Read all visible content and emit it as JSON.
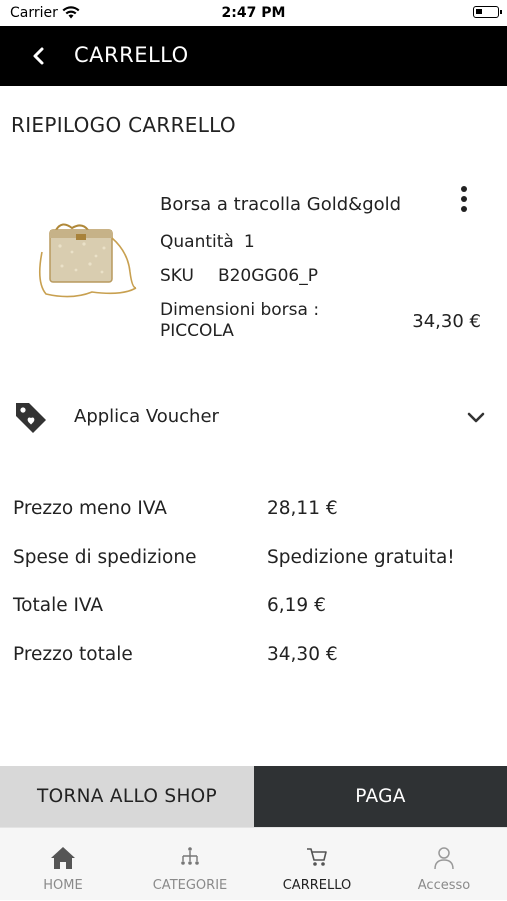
{
  "status_bar": {
    "carrier": "Carrier",
    "time": "2:47 PM"
  },
  "nav": {
    "title": "CARRELLO",
    "back_icon": "chevron-left-icon"
  },
  "cart": {
    "section_title": "RIEPILOGO CARRELLO",
    "item": {
      "name": "Borsa a tracolla Gold&gold",
      "quantity_label": "Quantità",
      "quantity_value": "1",
      "sku_label": "SKU",
      "sku_value": "B20GG06_P",
      "dimension_text": "Dimensioni borsa : PICCOLA",
      "price": "34,30 €"
    }
  },
  "voucher": {
    "label": "Applica Voucher"
  },
  "summary": {
    "rows": [
      {
        "label": "Prezzo meno IVA",
        "value": "28,11 €"
      },
      {
        "label": "Spese di spedizione",
        "value": "Spedizione gratuita!"
      },
      {
        "label": "Totale IVA",
        "value": "6,19 €"
      },
      {
        "label": "Prezzo totale",
        "value": "34,30 €"
      }
    ]
  },
  "actions": {
    "back_to_shop": "TORNA ALLO SHOP",
    "pay": "PAGA"
  },
  "tabs": [
    {
      "label": "HOME",
      "icon": "home-icon"
    },
    {
      "label": "CATEGORIE",
      "icon": "categories-icon"
    },
    {
      "label": "CARRELLO",
      "icon": "cart-icon"
    },
    {
      "label": "Accesso",
      "icon": "user-icon"
    }
  ],
  "colors": {
    "nav_bg": "#000000",
    "pay_bg": "#2f3234",
    "shop_bg": "#d8d8d8",
    "tabbar_bg": "#f6f6f6"
  }
}
